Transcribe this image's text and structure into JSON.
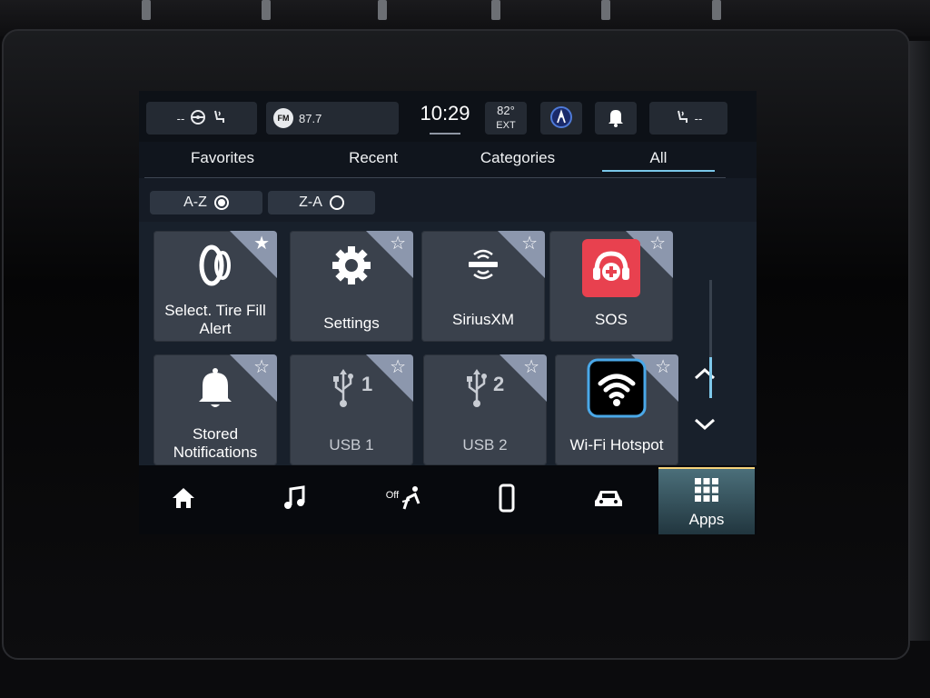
{
  "status_bar": {
    "seat_heat_left": "--",
    "radio_band": "FM",
    "radio_freq": "87.7",
    "clock": "10:29",
    "temp_value": "82°",
    "temp_label": "EXT",
    "seat_heat_right": "--"
  },
  "tabs": [
    {
      "label": "Favorites",
      "active": false
    },
    {
      "label": "Recent",
      "active": false
    },
    {
      "label": "Categories",
      "active": false
    },
    {
      "label": "All",
      "active": true
    }
  ],
  "sort": {
    "az_label": "A-Z",
    "za_label": "Z-A",
    "selected": "A-Z"
  },
  "apps": [
    {
      "label_line1": "Select. Tire Fill",
      "label_line2": "Alert",
      "icon": "tire-icon"
    },
    {
      "label_line1": "Settings",
      "label_line2": "",
      "icon": "gear-icon"
    },
    {
      "label_line1": "SiriusXM",
      "label_line2": "",
      "icon": "siriusxm-icon"
    },
    {
      "label_line1": "SOS",
      "label_line2": "",
      "icon": "sos-icon"
    },
    {
      "label_line1": "Stored",
      "label_line2": "Notifications",
      "icon": "bell-icon"
    },
    {
      "label_line1": "USB 1",
      "label_line2": "",
      "icon": "usb-icon",
      "badge": "1"
    },
    {
      "label_line1": "USB 2",
      "label_line2": "",
      "icon": "usb-icon",
      "badge": "2"
    },
    {
      "label_line1": "Wi-Fi Hotspot",
      "label_line2": "",
      "icon": "wifi-icon"
    }
  ],
  "nav": {
    "climate_off_label": "Off",
    "apps_label": "Apps"
  },
  "colors": {
    "accent": "#79c6e8",
    "sos_red": "#e8414f",
    "tile": "#3a414c",
    "star_corner": "#8c97ad"
  }
}
